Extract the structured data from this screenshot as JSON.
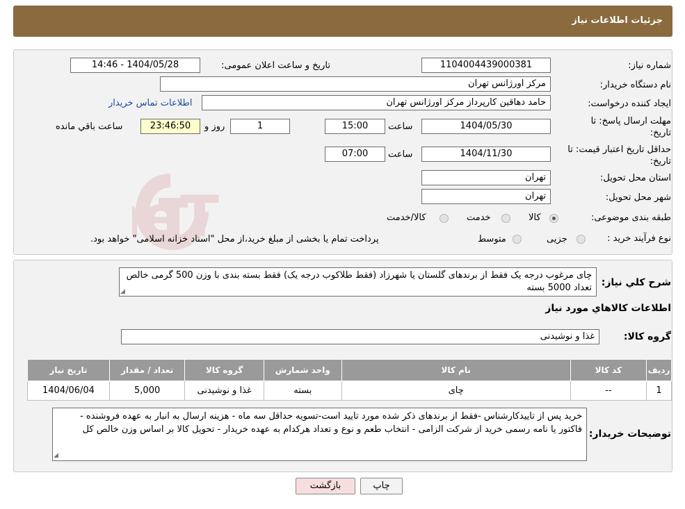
{
  "header": {
    "title": "جزئیات اطلاعات نیاز"
  },
  "form": {
    "need_number": {
      "label": "شماره نیاز:",
      "value": "1104004439000381"
    },
    "announce_datetime": {
      "label": "تاریخ و ساعت اعلان عمومی:",
      "value": "1404/05/28 - 14:46"
    },
    "buyer_org": {
      "label": "نام دستگاه خریدار:",
      "value": "مرکز اورژانس تهران"
    },
    "requester": {
      "label": "ایجاد کننده درخواست:",
      "value": "حامد دهاقین کارپرداز مرکز اورژانس تهران",
      "contact_link": "اطلاعات تماس خریدار"
    },
    "reply_deadline": {
      "label": "مهلت ارسال پاسخ: تا تاریخ:",
      "date": "1404/05/30",
      "time_label": "ساعت",
      "time": "15:00",
      "days": "1",
      "days_label": "روز و",
      "remaining": "23:46:50",
      "remaining_label": "ساعت باقي مانده"
    },
    "price_validity": {
      "label": "حداقل تاریخ اعتبار قیمت: تا تاریخ:",
      "date": "1404/11/30",
      "time_label": "ساعت",
      "time": "07:00"
    },
    "delivery_province": {
      "label": "استان محل تحویل:",
      "value": "تهران"
    },
    "delivery_city": {
      "label": "شهر محل تحویل:",
      "value": "تهران"
    },
    "category": {
      "label": "طبقه بندی موضوعی:",
      "options": [
        "کالا",
        "خدمت",
        "کالا/خدمت"
      ],
      "selected": "کالا"
    },
    "purchase_type": {
      "label": "نوع فرآیند خرید :",
      "options": [
        "جزیی",
        "متوسط"
      ],
      "note": "پرداخت تمام یا بخشی از مبلغ خرید،از محل \"اسناد خزانه اسلامی\" خواهد بود."
    }
  },
  "description": {
    "label": "شرح کلي نياز:",
    "value": "چای مرغوب درجه یک فقط از برندهای گلستان یا شهرزاد (فقط طلاکوب درجه یک) فقط بسته بندی با وزن 500 گرمی خالص تعداد 5000 بسته"
  },
  "items_section": {
    "title": "اطلاعات کالاهاي مورد نياز",
    "group_label": "گروه کالا:",
    "group_value": "غذا و نوشیدنی",
    "columns": [
      "رديف",
      "کد کالا",
      "نام کالا",
      "واحد شمارش",
      "گروه کالا",
      "تعداد / مقدار",
      "تاریخ نیاز"
    ],
    "rows": [
      [
        "1",
        "--",
        "چای",
        "بسته",
        "غذا و نوشیدنی",
        "5,000",
        "1404/06/04"
      ]
    ]
  },
  "buyer_notes": {
    "label": "توضیحات خریدار:",
    "value": "خرید پس از تاییدکارشناس -فقط از برندهای ذکر شده مورد تایید است-تسویه حداقل سه ماه - هزینه ارسال به انبار به عهده فروشنده - فاکتور یا نامه رسمی خرید از شرکت الزامی - انتخاب طعم و نوع و تعداد هرکدام به عهده خریدار - تحویل کالا بر اساس وزن خالص کل"
  },
  "buttons": {
    "print": "چاپ",
    "back": "بازگشت"
  },
  "watermark": "AriaTender.neT",
  "colors": {
    "header": "#8b6a3e",
    "link": "#1a4ba3",
    "back_button": "#f7dede"
  }
}
